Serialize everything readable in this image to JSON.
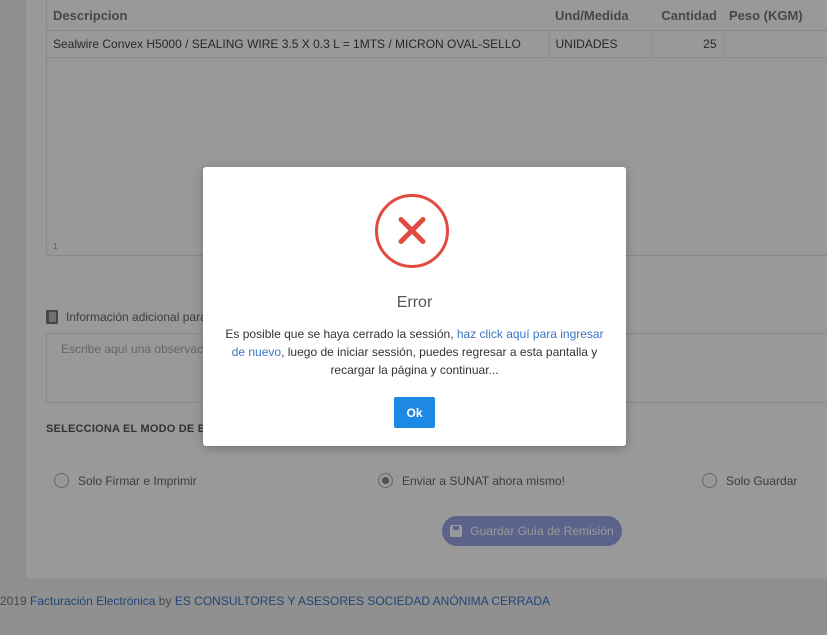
{
  "table": {
    "headers": [
      "Descripcion",
      "Und/Medida",
      "Cantidad",
      "Peso (KGM)"
    ],
    "rows": [
      {
        "descripcion": "Sealwire Convex H5000 / SEALING WIRE 3.5 X 0.3 L = 1MTS / MICRON OVAL-SELLO",
        "unidad": "UNIDADES",
        "cantidad": "25",
        "peso": ""
      }
    ],
    "footer_mark": "1"
  },
  "info": {
    "label": "Información adicional para la guía",
    "placeholder": "Escribe aquí una observación"
  },
  "send_mode": {
    "title": "SELECCIONA EL MODO DE ENVÍO",
    "options": [
      {
        "label": "Solo Firmar e Imprimir",
        "checked": false
      },
      {
        "label": "Enviar a SUNAT ahora mismo!",
        "checked": true
      },
      {
        "label": "Solo Guardar",
        "checked": false
      }
    ],
    "save_label": "Guardar Guía de Remisión"
  },
  "footer": {
    "year": "2019",
    "app_link": "Facturación Electrónica",
    "by": "by",
    "company_link": "ES CONSULTORES Y ASESORES SOCIEDAD ANÓNIMA CERRADA"
  },
  "modal": {
    "title": "Error",
    "msg_before": "Es posible que se haya cerrado la sessión, ",
    "msg_link": "haz click aquí para ingresar de nuevo",
    "msg_after": ", luego de iniciar sessión, puedes regresar a esta pantalla y recargar la página y continuar...",
    "ok_label": "Ok",
    "icon": "error-x-icon",
    "accent": "#e04a3f"
  }
}
